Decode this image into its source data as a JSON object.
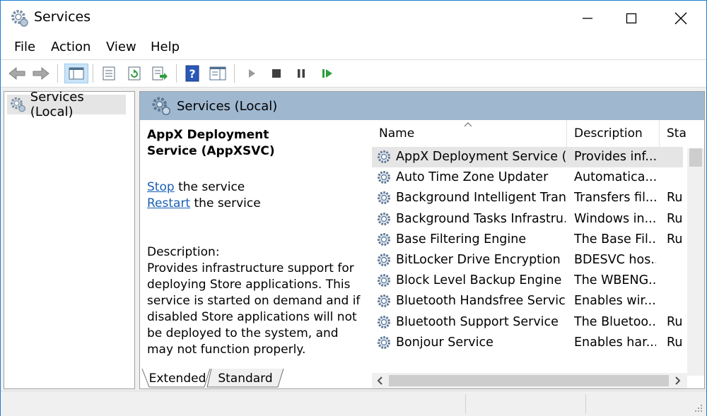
{
  "window": {
    "title": "Services"
  },
  "menu": [
    "File",
    "Action",
    "View",
    "Help"
  ],
  "tree": {
    "item": "Services (Local)"
  },
  "pane": {
    "header": "Services (Local)",
    "service_name": "AppX Deployment Service (AppXSVC)",
    "stop_link": "Stop",
    "stop_suffix": "the service",
    "restart_link": "Restart",
    "restart_suffix": "the service",
    "description_label": "Description:",
    "description_text": "Provides infrastructure support for deploying Store applications. This service is started on demand and if disabled Store applications will not be deployed to the system, and may not function properly."
  },
  "columns": {
    "name": "Name",
    "description": "Description",
    "status": "Sta"
  },
  "rows": [
    {
      "name": "AppX Deployment Service (...",
      "description": "Provides inf...",
      "status": ""
    },
    {
      "name": "Auto Time Zone Updater",
      "description": "Automatica...",
      "status": ""
    },
    {
      "name": "Background Intelligent Tran...",
      "description": "Transfers fil...",
      "status": "Ru"
    },
    {
      "name": "Background Tasks Infrastru...",
      "description": "Windows in...",
      "status": "Ru"
    },
    {
      "name": "Base Filtering Engine",
      "description": "The Base Fil...",
      "status": "Ru"
    },
    {
      "name": "BitLocker Drive Encryption ...",
      "description": "BDESVC hos...",
      "status": ""
    },
    {
      "name": "Block Level Backup Engine ...",
      "description": "The WBENG...",
      "status": ""
    },
    {
      "name": "Bluetooth Handsfree Service",
      "description": "Enables wir...",
      "status": ""
    },
    {
      "name": "Bluetooth Support Service",
      "description": "The Bluetoo...",
      "status": "Ru"
    },
    {
      "name": "Bonjour Service",
      "description": "Enables har...",
      "status": "Ru"
    }
  ],
  "tabs": {
    "extended": "Extended",
    "standard": "Standard"
  },
  "colors": {
    "accent": "#1b7fd6",
    "pane_header": "#9fb8d0",
    "link": "#1a5fb4"
  }
}
